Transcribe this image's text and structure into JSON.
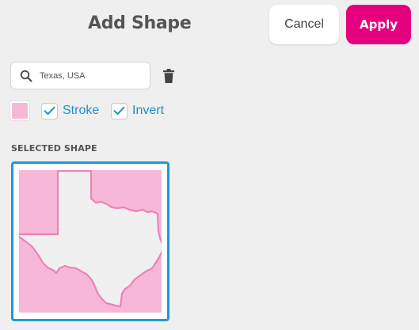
{
  "header": {
    "title": "Add Shape",
    "cancel_label": "Cancel",
    "apply_label": "Apply"
  },
  "search": {
    "value": "Texas, USA",
    "icon": "search-icon"
  },
  "toolbar": {
    "delete_icon": "trash-icon",
    "fill_color": "#f7b8d8"
  },
  "options": {
    "stroke": {
      "label": "Stroke",
      "checked": true
    },
    "invert": {
      "label": "Invert",
      "checked": true
    }
  },
  "selected": {
    "heading": "SELECTED SHAPE",
    "shape_name": "Texas"
  },
  "colors": {
    "accent": "#e5007e",
    "link": "#1e8fcf",
    "selection_border": "#1e9ad6",
    "shape_fill": "#f7b8d8",
    "shape_stroke": "#ee82b6"
  }
}
